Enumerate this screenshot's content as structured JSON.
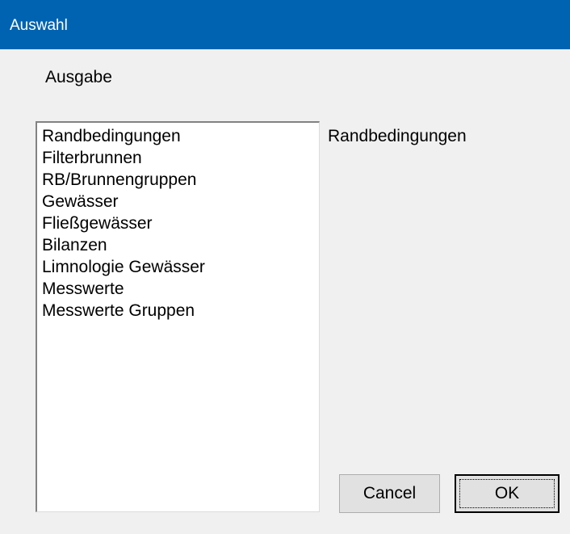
{
  "window": {
    "title": "Auswahl",
    "accent": "#0063b1"
  },
  "group_label": "Ausgabe",
  "list": {
    "items": [
      "Randbedingungen",
      "Filterbrunnen",
      "RB/Brunnengruppen",
      "Gewässer",
      "Fließgewässer",
      "Bilanzen",
      "Limnologie Gewässer",
      "Messwerte",
      "Messwerte Gruppen"
    ]
  },
  "selection": "Randbedingungen",
  "buttons": {
    "cancel": "Cancel",
    "ok": "OK"
  }
}
